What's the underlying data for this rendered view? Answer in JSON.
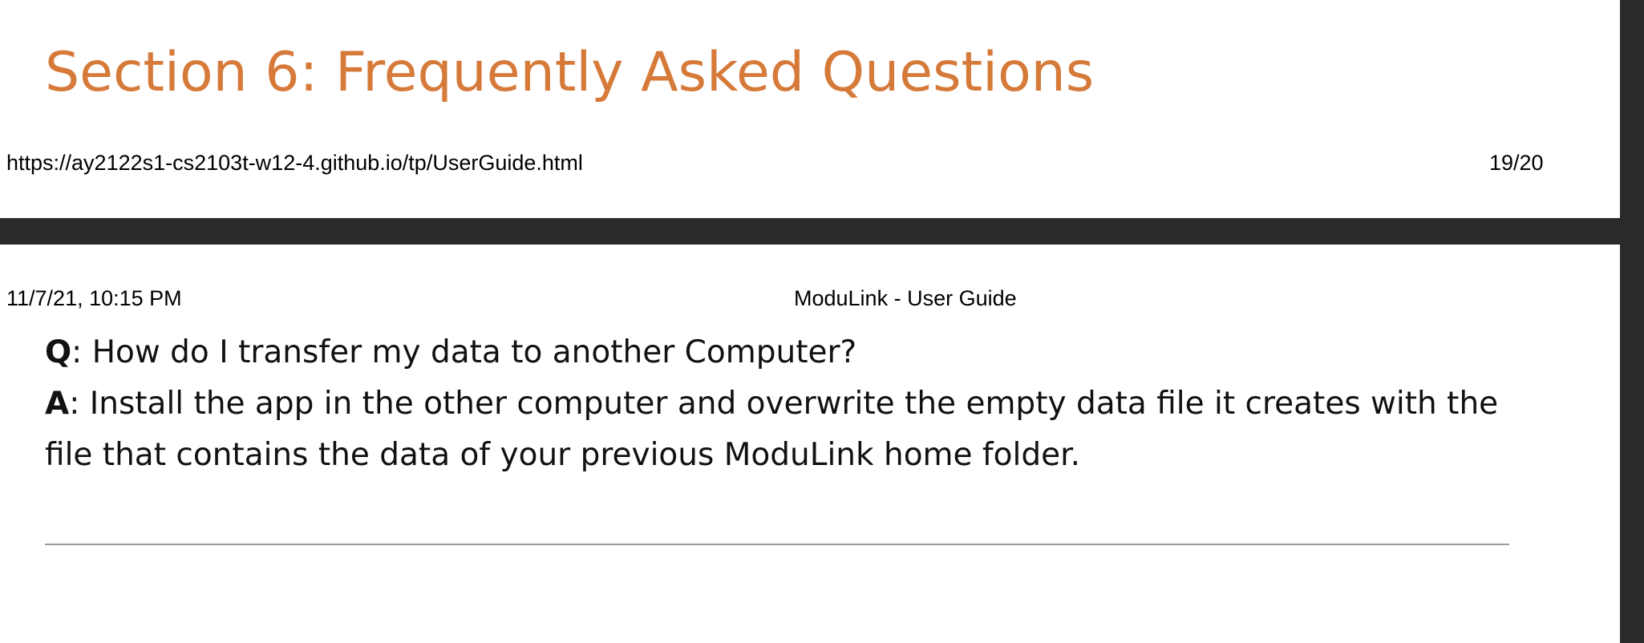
{
  "previous_page": {
    "section_heading": "Section 6: Frequently Asked Questions",
    "footer_url": "https://ay2122s1-cs2103t-w12-4.github.io/tp/UserGuide.html",
    "footer_page_number": "19/20"
  },
  "current_page": {
    "header_date": "11/7/21, 10:15 PM",
    "header_title": "ModuLink - User Guide",
    "faq": {
      "question_label": "Q",
      "question_text": ": How do I transfer my data to another Computer?",
      "answer_label": "A",
      "answer_text": ": Install the app in the other computer and overwrite the empty data file it creates with the file that contains the data of your previous ModuLink home folder."
    }
  },
  "colors": {
    "heading": "#d67a3a",
    "page_gap": "#2a2a2a",
    "rule": "#9a9a9a"
  }
}
